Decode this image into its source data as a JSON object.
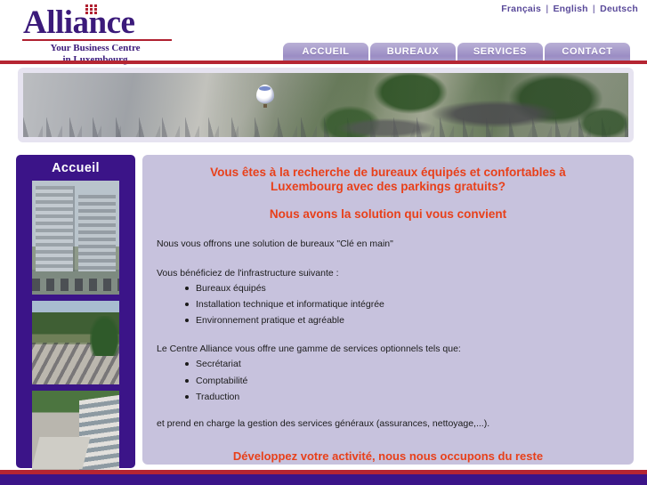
{
  "header": {
    "languages": [
      {
        "label": "Français"
      },
      {
        "label": "English"
      },
      {
        "label": "Deutsch"
      }
    ],
    "lang_separator": "|",
    "logo": {
      "word": "Alliance",
      "tagline_line1": "Your Business Centre",
      "tagline_line2": "in Luxembourg"
    },
    "nav": [
      {
        "label": "ACCUEIL"
      },
      {
        "label": "BUREAUX"
      },
      {
        "label": "SERVICES"
      },
      {
        "label": "CONTACT"
      }
    ]
  },
  "banner": {
    "alt": "Aerial photograph of Luxembourg city with a hot air balloon"
  },
  "sidebar": {
    "title": "Accueil",
    "photos": [
      {
        "alt": "Office tower buildings with car park"
      },
      {
        "alt": "Parking area surrounded by wooded hills"
      },
      {
        "alt": "Aerial view of the building courtyard"
      }
    ]
  },
  "content": {
    "heading_main_line1": "Vous êtes à la recherche de bureaux équipés et confortables à",
    "heading_main_line2": "Luxembourg avec des parkings gratuits?",
    "heading_second": "Nous avons la solution qui vous convient",
    "para_offer": "Nous vous offrons une solution de bureaux \"Clé en main\"",
    "para_infra": "Vous bénéficiez de l'infrastructure suivante :",
    "list_infra": [
      "Bureaux équipés",
      "Installation technique et informatique intégrée",
      "Environnement pratique et agréable"
    ],
    "para_services": "Le Centre Alliance vous offre une gamme de services optionnels tels que:",
    "list_services": [
      "Secrétariat",
      "Comptabilité",
      "Traduction"
    ],
    "para_general": "et prend en charge la gestion des services généraux (assurances, nettoyage,...).",
    "heading_closing": "Développez votre activité, nous nous occupons du reste"
  },
  "colors": {
    "brand_purple": "#3b1488",
    "accent_red": "#b52532",
    "heading_red": "#e8401a",
    "content_bg": "#c7c2dd",
    "nav_button": "#a79bcb",
    "banner_bg": "#e6e3f0"
  }
}
